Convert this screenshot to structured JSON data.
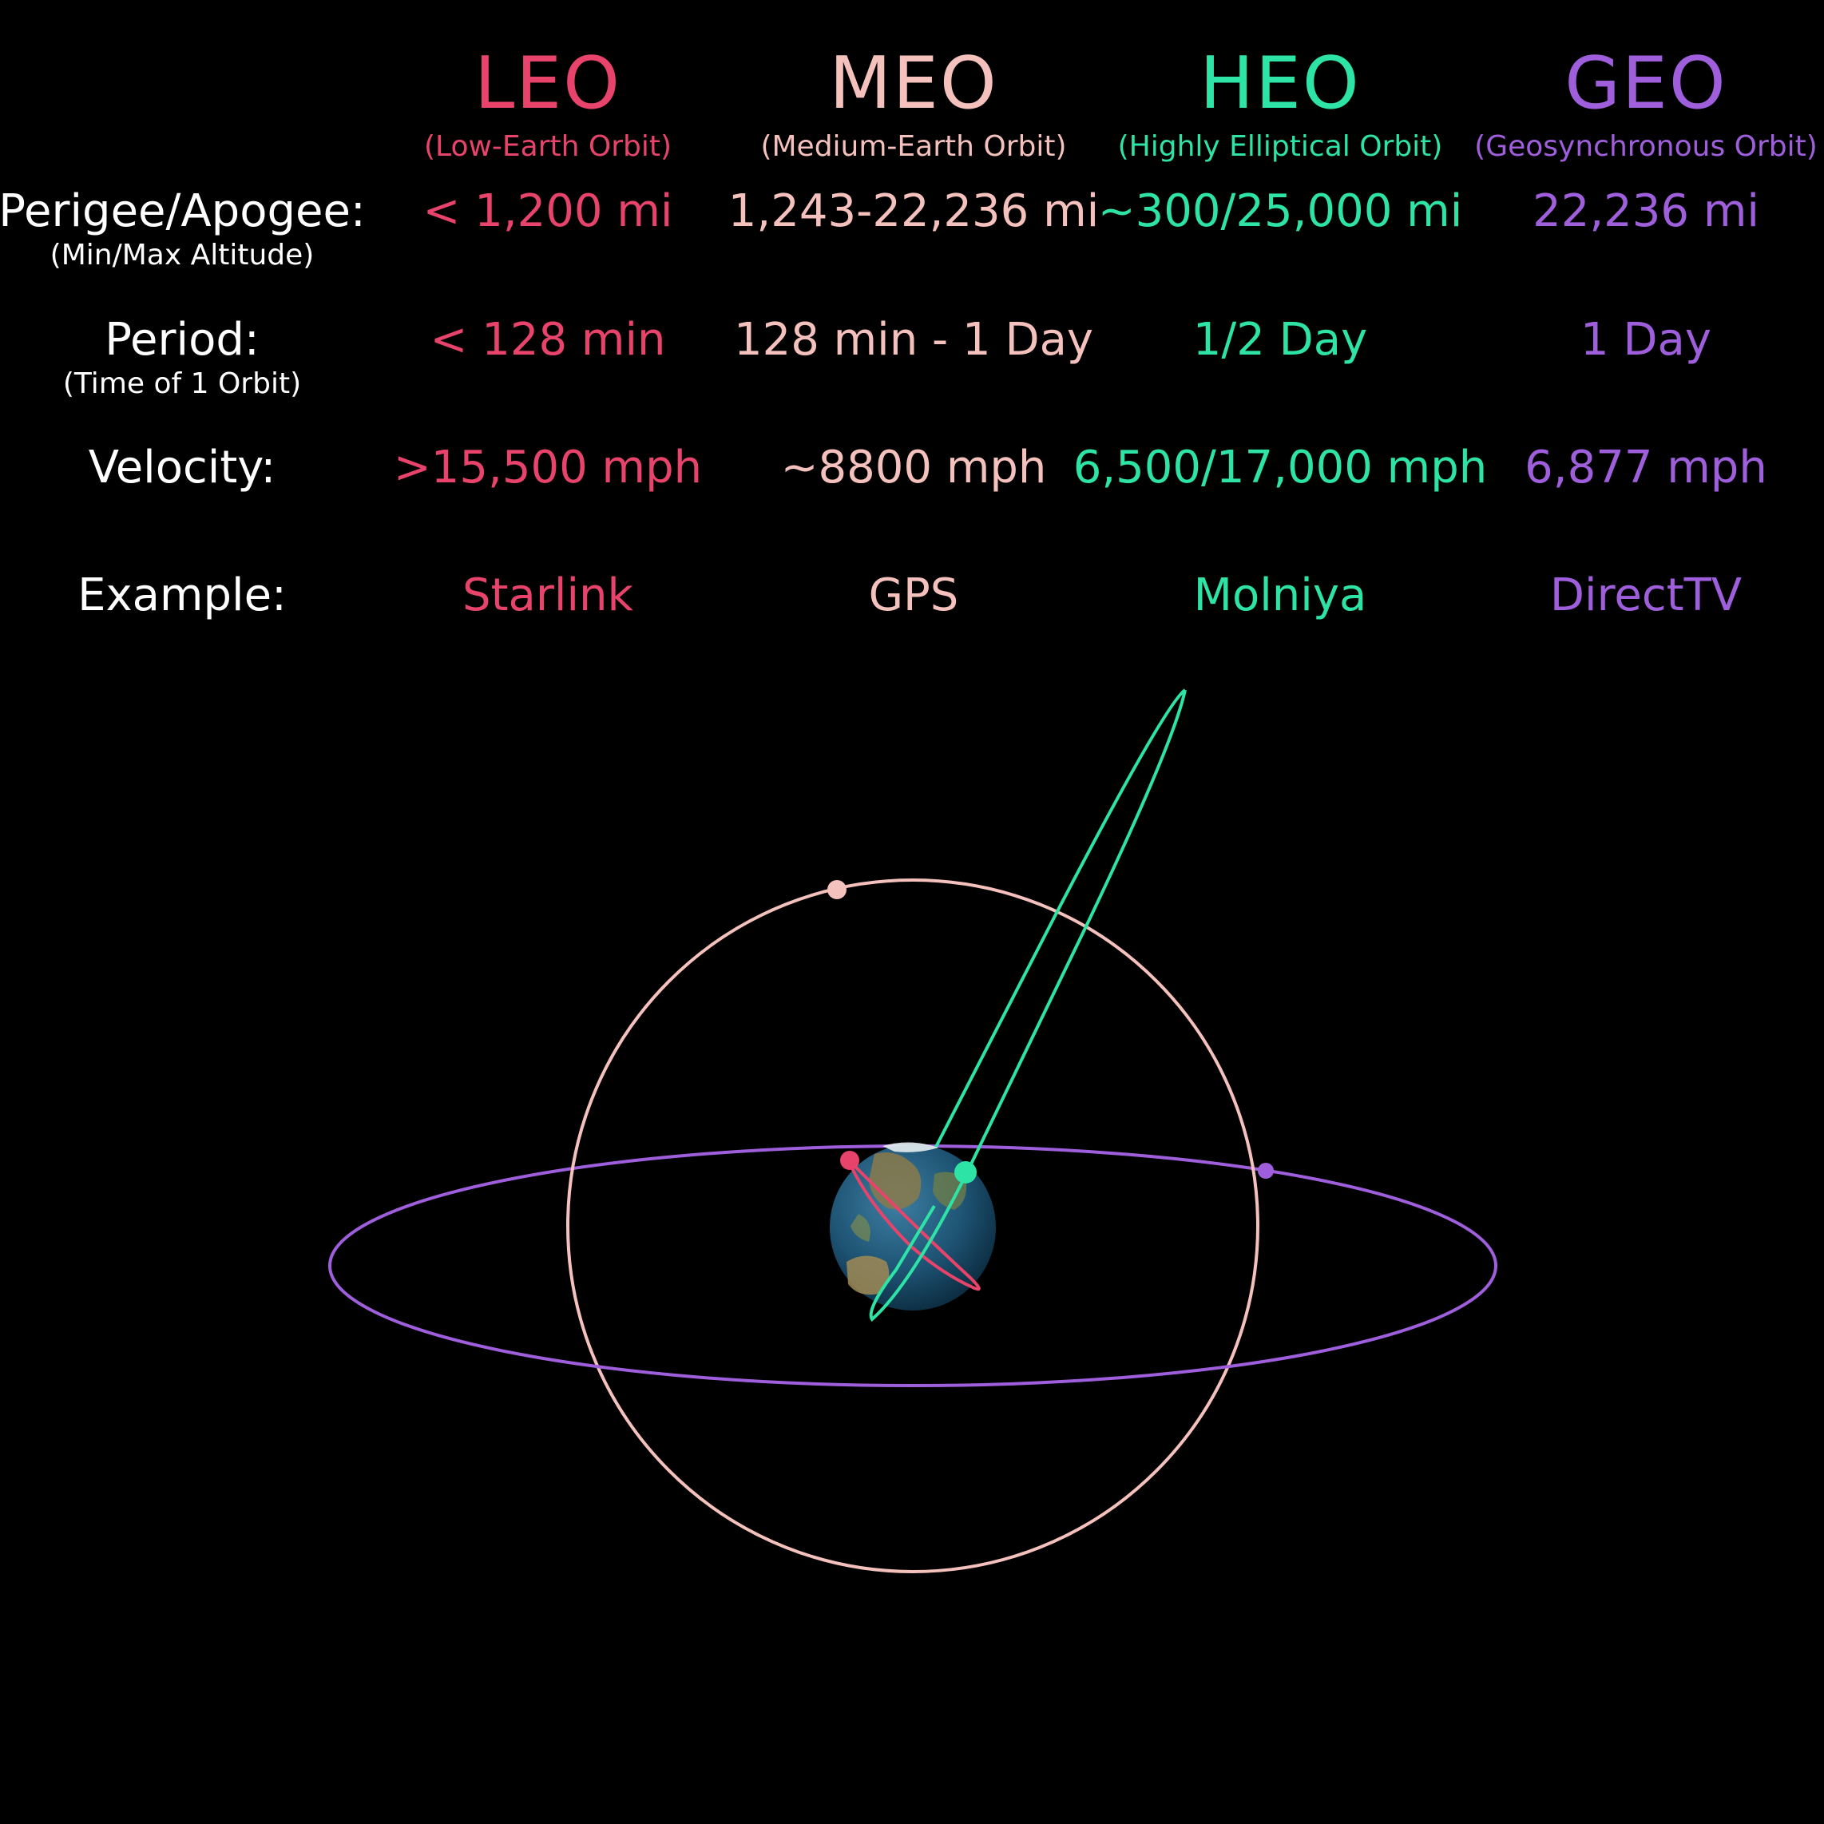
{
  "colors": {
    "background": "#000000",
    "leo": "#e8436a",
    "meo": "#f5c1bd",
    "heo": "#2de3a6",
    "geo": "#9f5fdc",
    "label": "#ffffff"
  },
  "columns": {
    "leo": {
      "name": "LEO",
      "full": "(Low-Earth Orbit)",
      "perigee_apogee": "< 1,200 mi",
      "period": "< 128 min",
      "velocity": ">15,500 mph",
      "example": "Starlink"
    },
    "meo": {
      "name": "MEO",
      "full": "(Medium-Earth Orbit)",
      "perigee_apogee": "1,243-22,236 mi",
      "period": "128 min - 1 Day",
      "velocity": "~8800 mph",
      "example": "GPS"
    },
    "heo": {
      "name": "HEO",
      "full": "(Highly Elliptical Orbit)",
      "perigee_apogee": "~300/25,000 mi",
      "period": "1/2 Day",
      "velocity": "6,500/17,000 mph",
      "example": "Molniya"
    },
    "geo": {
      "name": "GEO",
      "full": "(Geosynchronous Orbit)",
      "perigee_apogee": "22,236 mi",
      "period": "1 Day",
      "velocity": "6,877 mph",
      "example": "DirectTV"
    }
  },
  "rows": {
    "perigee": {
      "label": "Perigee/Apogee:",
      "sub": "(Min/Max Altitude)"
    },
    "period": {
      "label": "Period:",
      "sub": "(Time of 1 Orbit)"
    },
    "velocity": {
      "label": "Velocity:"
    },
    "example": {
      "label": "Example:"
    }
  },
  "diagram": {
    "center_icon": "earth-globe-icon",
    "orbits": [
      "leo",
      "meo",
      "heo",
      "geo"
    ]
  }
}
